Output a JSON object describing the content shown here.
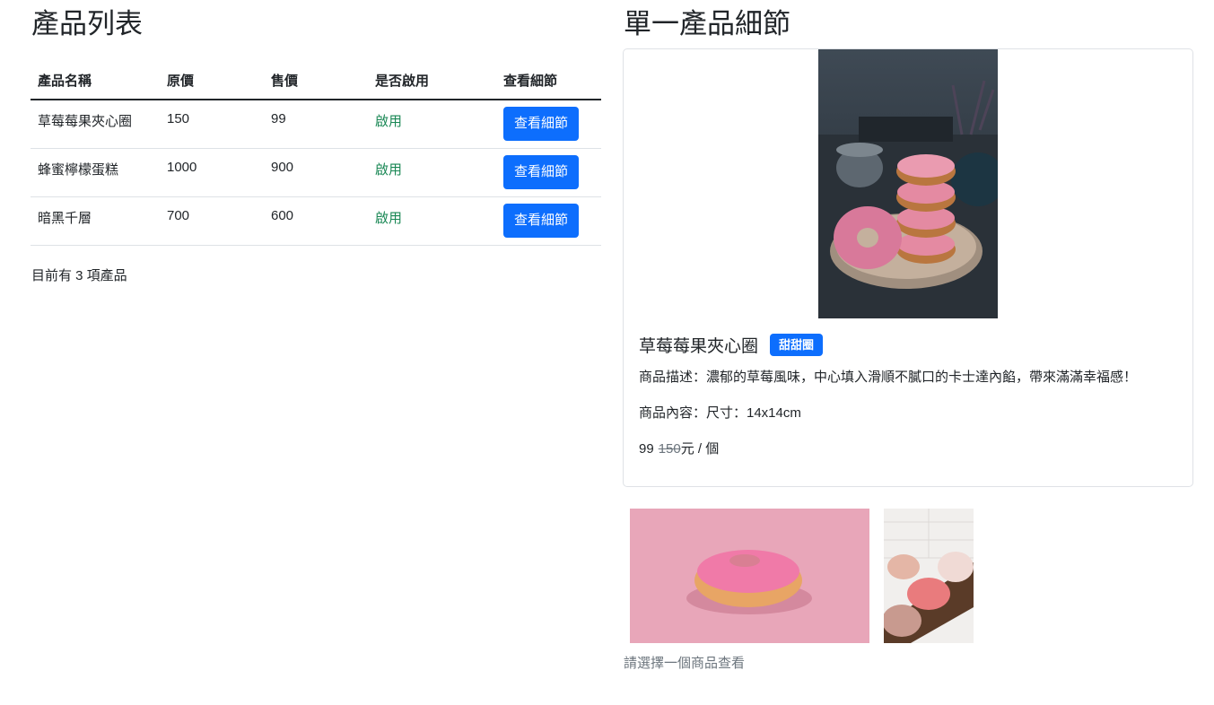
{
  "list": {
    "title": "產品列表",
    "headers": [
      "產品名稱",
      "原價",
      "售價",
      "是否啟用",
      "查看細節"
    ],
    "rows": [
      {
        "name": "草莓莓果夾心圈",
        "origin_price": "150",
        "price": "99",
        "status": "啟用",
        "button": "查看細節"
      },
      {
        "name": "蜂蜜檸檬蛋糕",
        "origin_price": "1000",
        "price": "900",
        "status": "啟用",
        "button": "查看細節"
      },
      {
        "name": "暗黑千層",
        "origin_price": "700",
        "price": "600",
        "status": "啟用",
        "button": "查看細節"
      }
    ],
    "count_text": "目前有 3 項產品"
  },
  "detail": {
    "title": "單一產品細節",
    "product_name": "草莓莓果夾心圈",
    "category_badge": "甜甜圈",
    "description": "商品描述：濃郁的草莓風味，中心填入滑順不膩口的卡士達內餡，帶來滿滿幸福感！",
    "content": "商品內容：尺寸：14x14cm",
    "price": "99",
    "origin_price": "150",
    "unit_suffix": "元 / 個",
    "hint": "請選擇一個商品查看"
  },
  "colors": {
    "primary": "#0d6efd",
    "success": "#198754",
    "muted": "#6c757d"
  }
}
